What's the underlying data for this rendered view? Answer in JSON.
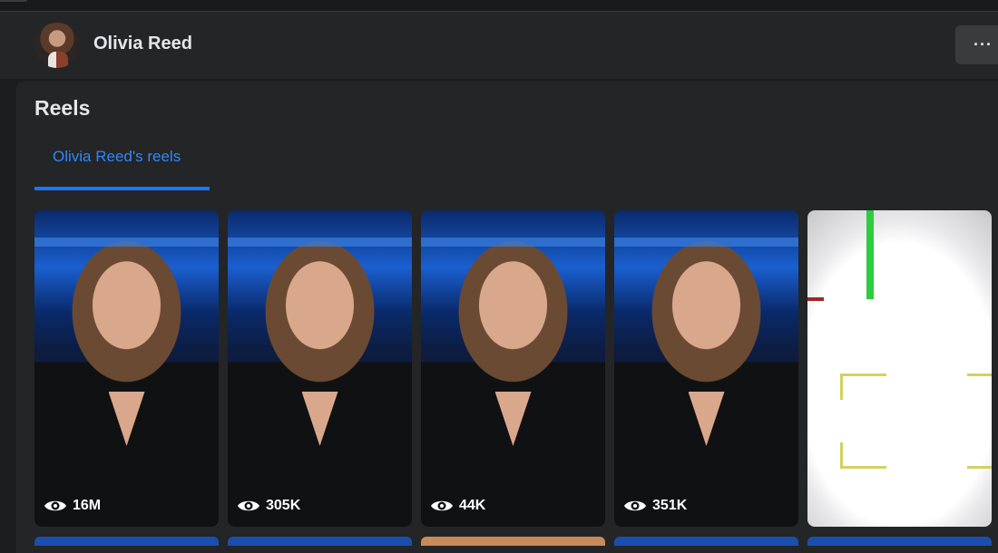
{
  "profile": {
    "name": "Olivia Reed",
    "more_label": "···"
  },
  "reels_section": {
    "title": "Reels",
    "tab_label": "Olivia Reed's reels",
    "items": [
      {
        "views": "16M",
        "thumbnail": "news-anchor"
      },
      {
        "views": "305K",
        "thumbnail": "news-anchor"
      },
      {
        "views": "44K",
        "thumbnail": "news-anchor"
      },
      {
        "views": "351K",
        "thumbnail": "news-anchor"
      },
      {
        "views": "",
        "thumbnail": "white-screen"
      }
    ]
  },
  "colors": {
    "accent": "#2d88ff",
    "tab_underline": "#1877f2",
    "background": "#1c1d1f",
    "card": "#242526"
  },
  "icons": {
    "views": "eye-icon",
    "more": "more-options-icon"
  }
}
